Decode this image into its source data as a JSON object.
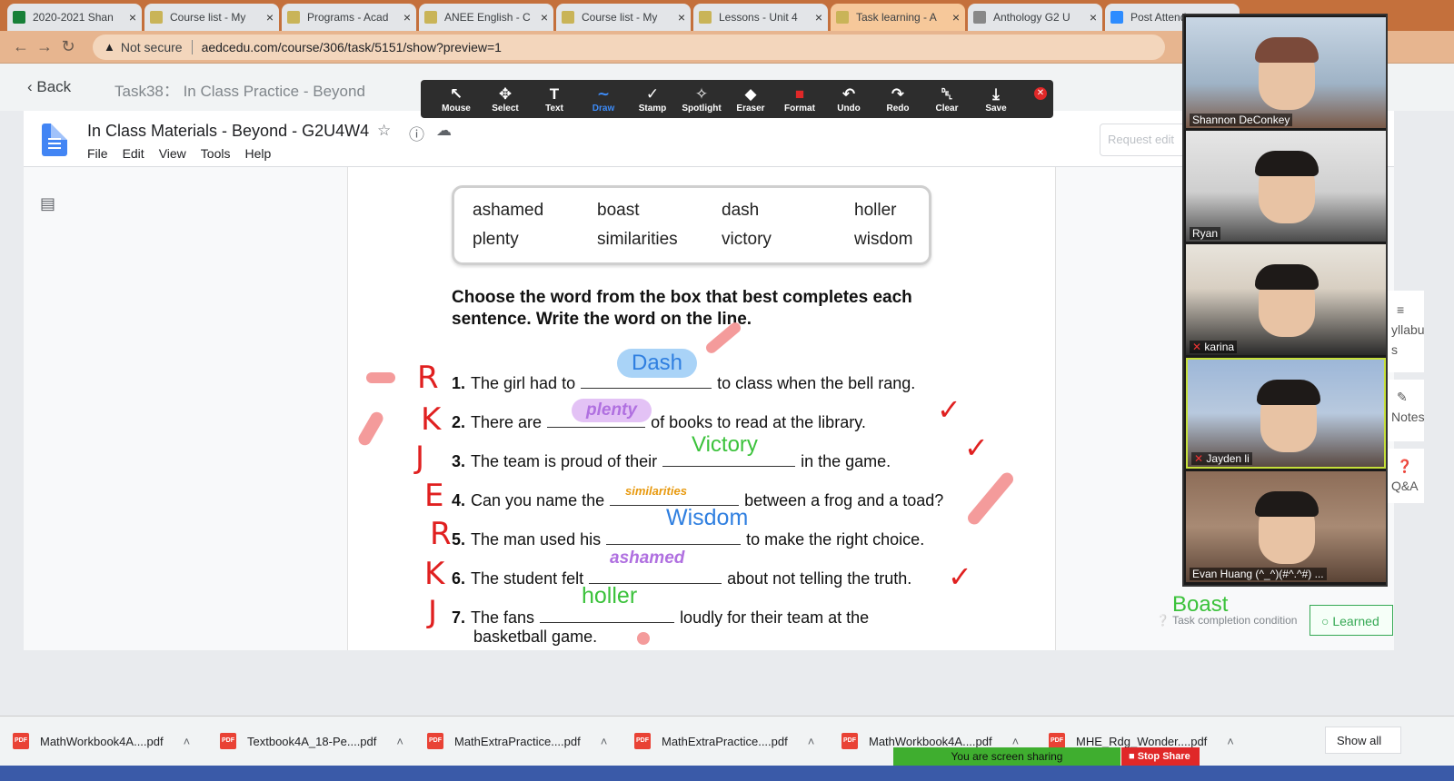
{
  "browser": {
    "tabs": [
      {
        "title": "2020-2021 Shan",
        "favicon": "green"
      },
      {
        "title": "Course list - My",
        "favicon": "khaki"
      },
      {
        "title": "Programs - Acad",
        "favicon": "khaki"
      },
      {
        "title": "ANEE English - C",
        "favicon": "khaki"
      },
      {
        "title": "Course list - My",
        "favicon": "khaki"
      },
      {
        "title": "Lessons - Unit 4",
        "favicon": "khaki"
      },
      {
        "title": "Task learning - A",
        "favicon": "khaki",
        "active": true
      },
      {
        "title": "Anthology G2 U",
        "favicon": "gray"
      },
      {
        "title": "Post Attende",
        "favicon": "blue"
      }
    ],
    "security": "Not secure",
    "url": "aedcedu.com/course/306/task/5151/show?preview=1"
  },
  "page": {
    "back": "Back",
    "task_title": "Task38： In Class Practice - Beyond",
    "doc_title": "In Class Materials - Beyond - G2U4W4",
    "menus": [
      "File",
      "Edit",
      "View",
      "Tools",
      "Help"
    ],
    "request_edit": "Request edit"
  },
  "worksheet": {
    "words": [
      "ashamed",
      "boast",
      "dash",
      "holler",
      "plenty",
      "similarities",
      "victory",
      "wisdom"
    ],
    "instruction": "Choose the word from the box that best completes each sentence. Write the word on the line.",
    "sentences": [
      {
        "num": "1.",
        "before": "The girl had to",
        "after": "to class when the bell rang.",
        "answer": "Dash",
        "initial": "R"
      },
      {
        "num": "2.",
        "before": "There are",
        "after": "of books to read at the library.",
        "answer": "plenty",
        "initial": "K"
      },
      {
        "num": "3.",
        "before": "The team is proud of their",
        "after": "in the game.",
        "answer": "Victory",
        "initial": "J"
      },
      {
        "num": "4.",
        "before": "Can you name the",
        "after": "between a frog and a toad?",
        "answer": "similarities",
        "initial": "E"
      },
      {
        "num": "5.",
        "before": "The man used his",
        "after": "to make the right choice.",
        "answer": "Wisdom",
        "initial": "R"
      },
      {
        "num": "6.",
        "before": "The student felt",
        "after": "about not telling the truth.",
        "answer": "ashamed",
        "initial": "K"
      },
      {
        "num": "7.",
        "before": "The fans",
        "after": "loudly for their team at the",
        "after2": "basketball game.",
        "answer": "holler",
        "initial": "J"
      }
    ],
    "extra_answer": "Boast"
  },
  "task_footer": {
    "condition": "Task completion condition",
    "learned": "Learned"
  },
  "annotate_toolbar": [
    {
      "label": "Mouse",
      "icon": "↖"
    },
    {
      "label": "Select",
      "icon": "✥"
    },
    {
      "label": "Text",
      "icon": "T"
    },
    {
      "label": "Draw",
      "icon": "∼",
      "active": true
    },
    {
      "label": "Stamp",
      "icon": "✓"
    },
    {
      "label": "Spotlight",
      "icon": "✧"
    },
    {
      "label": "Eraser",
      "icon": "◆"
    },
    {
      "label": "Format",
      "icon": "■"
    },
    {
      "label": "Undo",
      "icon": "↶"
    },
    {
      "label": "Redo",
      "icon": "↷"
    },
    {
      "label": "Clear",
      "icon": "␡"
    },
    {
      "label": "Save",
      "icon": "⤓"
    }
  ],
  "participants": [
    {
      "name": "Shannon DeConkey",
      "muted": false
    },
    {
      "name": "Ryan",
      "muted": false
    },
    {
      "name": "karina",
      "muted": true
    },
    {
      "name": "Jayden li",
      "muted": true
    },
    {
      "name": "Evan Huang (^_^)(#^.^#) ...",
      "muted": false
    }
  ],
  "side_tabs": {
    "syllabus": "yllabu s",
    "notes": "Notes",
    "qa": "Q&A"
  },
  "downloads": [
    "MathWorkbook4A....pdf",
    "Textbook4A_18-Pe....pdf",
    "MathExtraPractice....pdf",
    "MathExtraPractice....pdf",
    "MathWorkbook4A....pdf",
    "MHE_Rdg_Wonder....pdf"
  ],
  "download_show_all": "Show all",
  "screen_share": {
    "status": "You are screen sharing",
    "stop": "Stop Share"
  },
  "colors": {
    "ink_red": "#e02020",
    "tab_orange": "#c4703c",
    "answer_blue": "#2f7fe0",
    "answer_green": "#3bc23b",
    "answer_purple": "#b070e0",
    "answer_orange": "#e89a10"
  }
}
